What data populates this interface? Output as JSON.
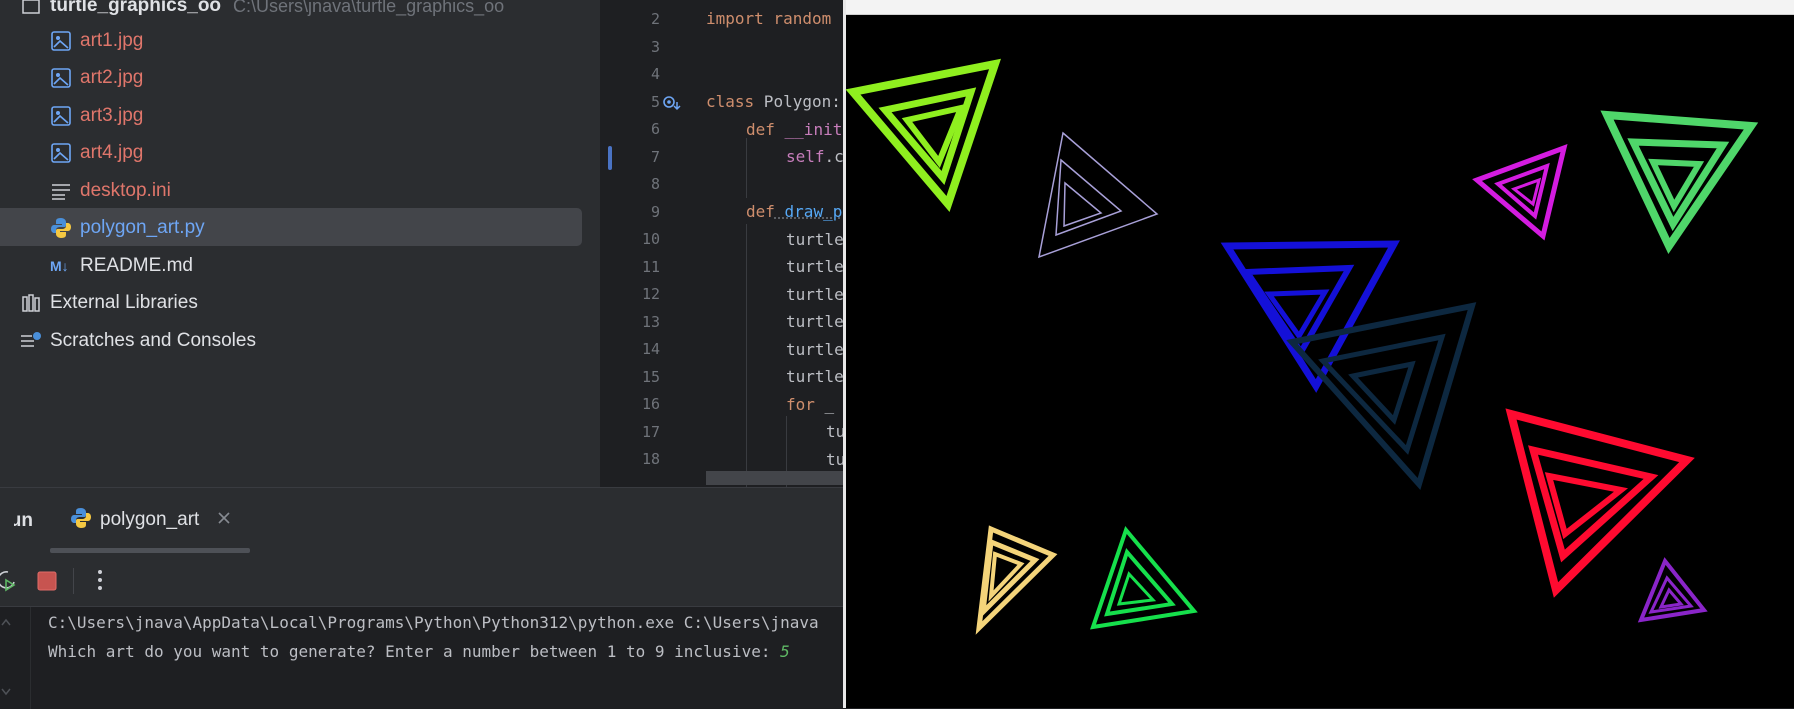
{
  "project": {
    "root": {
      "name": "turtle_graphics_oo",
      "path": "C:\\Users\\jnava\\turtle_graphics_oo"
    },
    "files": [
      {
        "name": "art1.jpg",
        "icon": "image-icon"
      },
      {
        "name": "art2.jpg",
        "icon": "image-icon"
      },
      {
        "name": "art3.jpg",
        "icon": "image-icon"
      },
      {
        "name": "art4.jpg",
        "icon": "image-icon"
      },
      {
        "name": "desktop.ini",
        "icon": "text-file-icon"
      },
      {
        "name": "polygon_art.py",
        "icon": "python-icon"
      },
      {
        "name": "README.md",
        "icon": "markdown-icon"
      }
    ],
    "external_libraries": "External Libraries",
    "scratches": "Scratches and Consoles"
  },
  "editor": {
    "line_numbers": [
      "2",
      "3",
      "4",
      "5",
      "6",
      "7",
      "8",
      "9",
      "10",
      "11",
      "12",
      "13",
      "14",
      "15",
      "16",
      "17",
      "18"
    ],
    "lines": {
      "l2": "import random",
      "l5_kw": "class",
      "l5_rest": " Polygon:",
      "l6_kw": "def",
      "l6_fn": " __init",
      "l7_self": "self",
      "l7_rest": ".c",
      "l9_kw": "def",
      "l9_fn": " draw_p",
      "turtle": "turtle",
      "l16_kw": "for",
      "l16_rest": " _",
      "tu": "tu"
    }
  },
  "run": {
    "tab_run": "Run",
    "tab_name": "polygon_art",
    "console": {
      "line1": "C:\\Users\\jnava\\AppData\\Local\\Programs\\Python\\Python312\\python.exe C:\\Users\\jnava",
      "prompt": "Which art do you want to generate? Enter a number between 1 to 9 inclusive: ",
      "input": "5"
    }
  },
  "colors": {
    "accent_blue": "#6ea6f5",
    "file_red": "#e0766b",
    "console_input_green": "#5fb865"
  }
}
